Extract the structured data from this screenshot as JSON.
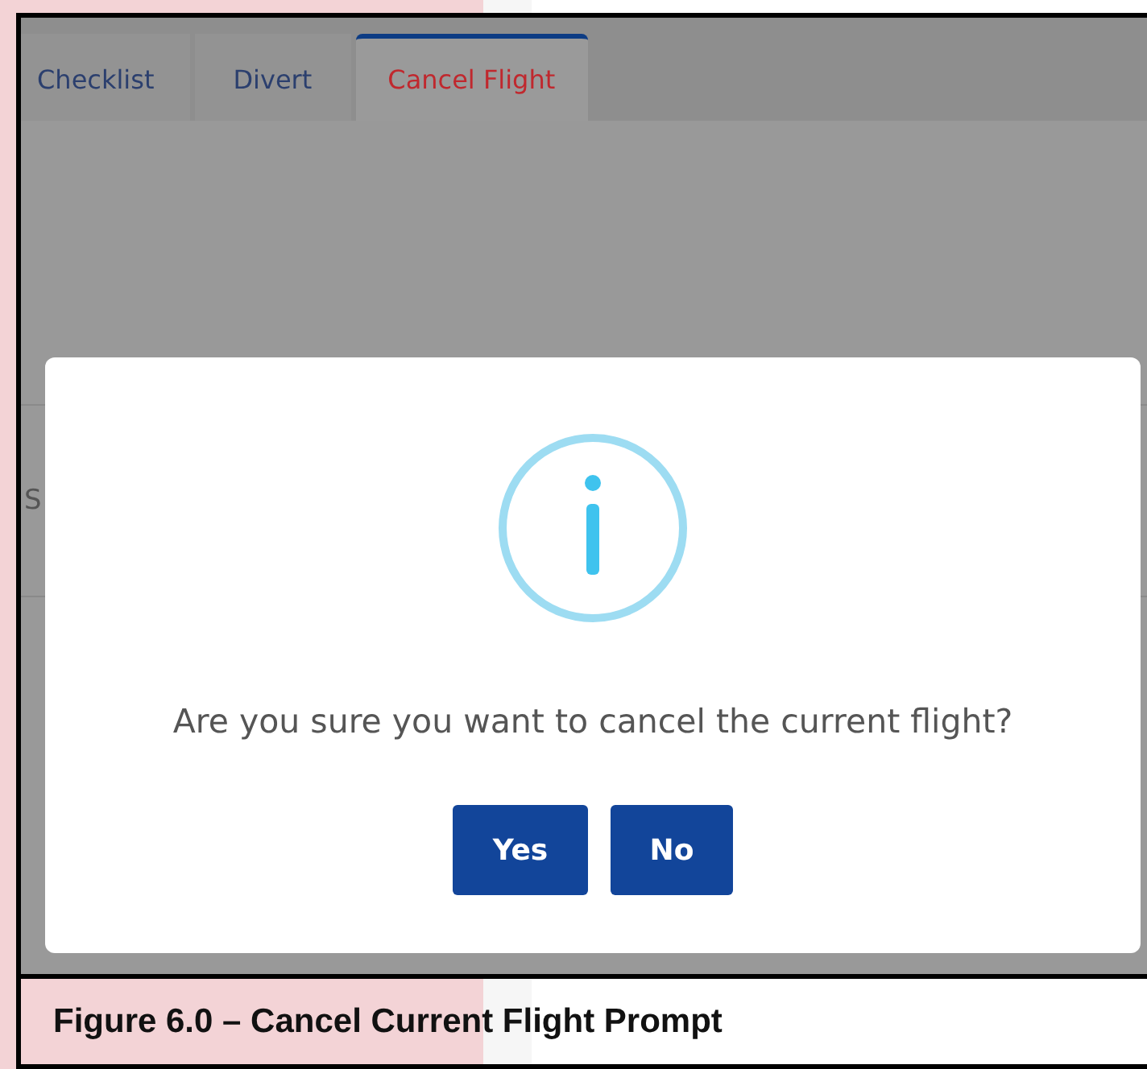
{
  "tabs": [
    {
      "label": "Checklist",
      "selected": false
    },
    {
      "label": "Divert",
      "selected": false
    },
    {
      "label": "Cancel Flight",
      "selected": true
    }
  ],
  "background_text": "S",
  "dialog": {
    "message": "Are you sure you want to cancel the current flight?",
    "buttons": [
      "Yes",
      "No"
    ]
  },
  "caption": "Figure 6.0 – Cancel Current Flight Prompt"
}
